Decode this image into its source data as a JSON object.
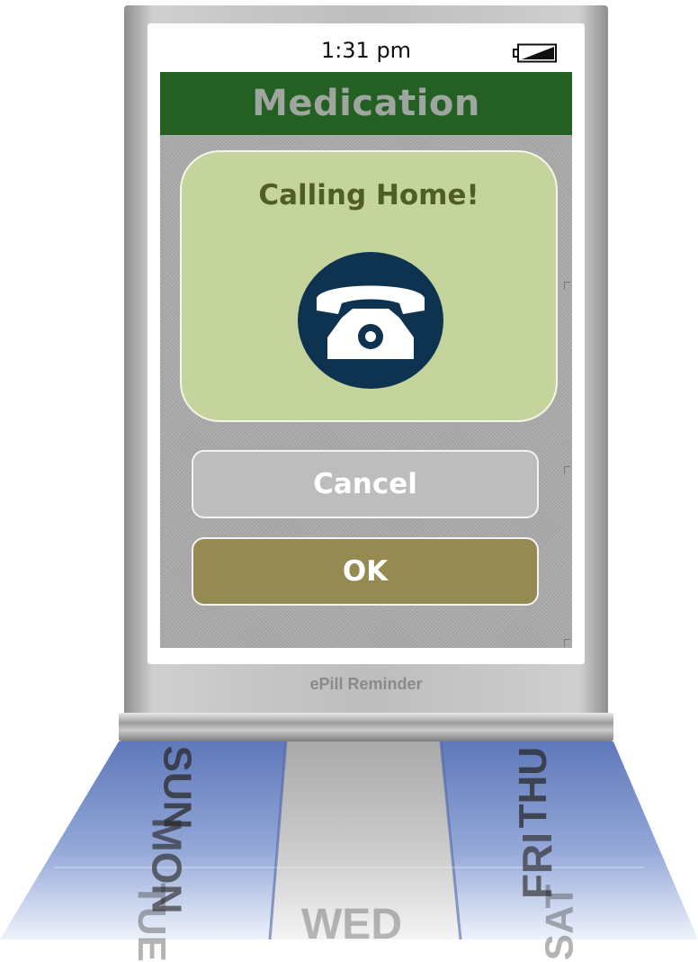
{
  "status": {
    "time": "1:31 pm",
    "battery_icon": "battery-icon"
  },
  "header": {
    "title": "Medication"
  },
  "call_card": {
    "title": "Calling Home!",
    "icon": "phone-icon"
  },
  "buttons": {
    "cancel_label": "Cancel",
    "ok_label": "OK"
  },
  "device": {
    "brand": "ePill Reminder"
  },
  "pillbox": {
    "days": [
      "SUN",
      "MON",
      "TUE",
      "WED",
      "THU",
      "FRI",
      "SAT"
    ]
  },
  "colors": {
    "header_bg": "#245f24",
    "header_text": "#9fa59f",
    "card_bg": "#c5d49c",
    "card_title": "#4f5f24",
    "icon_bg": "#0e3350",
    "cancel_bg": "#bdbdbd",
    "ok_bg": "#958a52",
    "pillbox_blue": "#6f86c6"
  }
}
